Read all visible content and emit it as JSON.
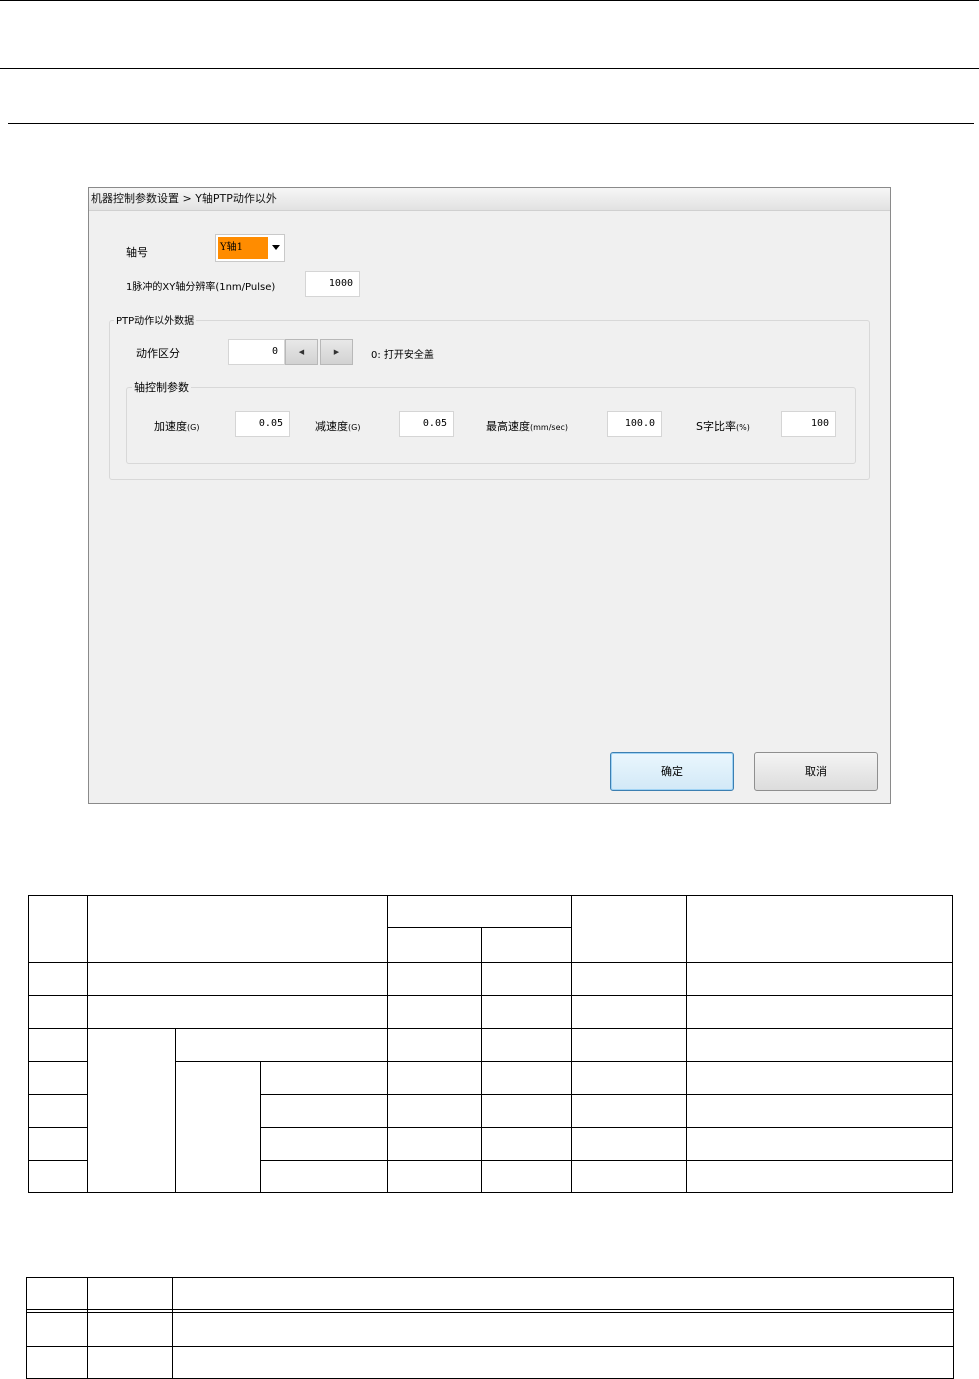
{
  "dialog": {
    "title": "机器控制参数设置 > Y轴PTP动作以外",
    "axis_label": "轴号",
    "axis_value": "Y轴1",
    "resolution_label": "1脉冲的XY轴分辨率(1nm/Pulse)",
    "resolution_value": "1000",
    "group_title": "PTP动作以外数据",
    "motion_label": "动作区分",
    "motion_value": "0",
    "motion_desc": "0: 打开安全盖",
    "axis_group_title": "轴控制参数",
    "accel_label": "加速度",
    "accel_unit": "(G)",
    "accel_value": "0.05",
    "decel_label": "减速度",
    "decel_unit": "(G)",
    "decel_value": "0.05",
    "maxspeed_label": "最高速度",
    "maxspeed_unit": "(mm/sec)",
    "maxspeed_value": "100.0",
    "scurve_label": "S字比率",
    "scurve_unit": "(%)",
    "scurve_value": "100",
    "ok_label": "确定",
    "cancel_label": "取消"
  },
  "icons": {
    "combo": "chevron-down-icon",
    "spin_left": "arrow-left-icon",
    "spin_right": "arrow-right-icon"
  }
}
